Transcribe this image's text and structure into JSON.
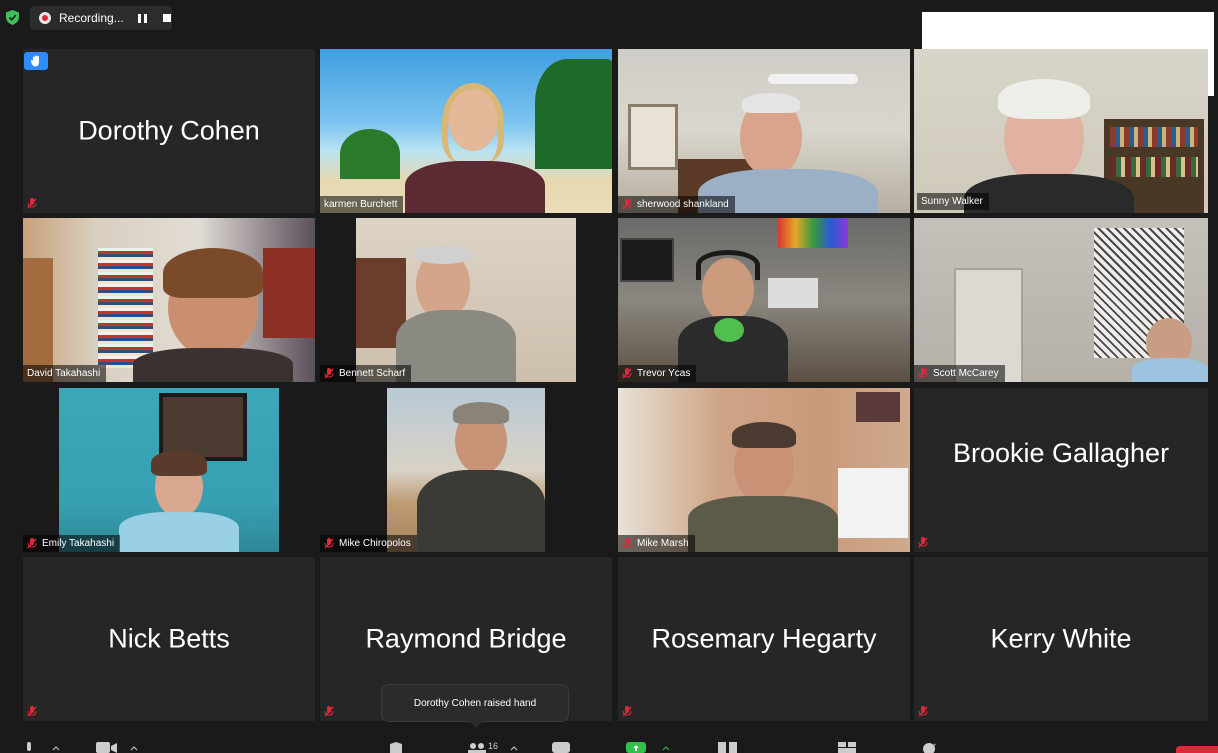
{
  "recording": {
    "label": "Recording..."
  },
  "participants": [
    {
      "name": "Dorothy Cohen",
      "video": false,
      "hand_raised": true
    },
    {
      "name": "karmen Burchett",
      "video": true,
      "muted": false
    },
    {
      "name": "sherwood shankland",
      "video": true,
      "muted": true
    },
    {
      "name": "Sunny Walker",
      "video": true,
      "muted": false,
      "active_speaker": true
    },
    {
      "name": "David Takahashi",
      "video": true,
      "muted": false
    },
    {
      "name": "Bennett Scharf",
      "video": true,
      "muted": true
    },
    {
      "name": "Trevor Ycas",
      "video": true,
      "muted": true
    },
    {
      "name": "Scott McCarey",
      "video": true,
      "muted": true
    },
    {
      "name": "Emily Takahashi",
      "video": true,
      "muted": true
    },
    {
      "name": "Mike Chiropolos",
      "video": true,
      "muted": true
    },
    {
      "name": "Mike Marsh",
      "video": true,
      "muted": true
    },
    {
      "name": "Brookie Gallagher",
      "video": false,
      "muted": true
    },
    {
      "name": "Nick Betts",
      "video": false,
      "muted": true
    },
    {
      "name": "Raymond Bridge",
      "video": false,
      "muted": true
    },
    {
      "name": "Rosemary Hegarty",
      "video": false,
      "muted": true
    },
    {
      "name": "Kerry White",
      "video": false,
      "muted": true
    }
  ],
  "tooltip": {
    "text": "Dorothy Cohen raised hand"
  },
  "toolbar": {
    "participants_count": "16"
  },
  "colors": {
    "accent_blue": "#2d8cff",
    "active_speaker": "#b7d84a",
    "muted_red": "#e0283b",
    "tile_bg": "#262626"
  }
}
